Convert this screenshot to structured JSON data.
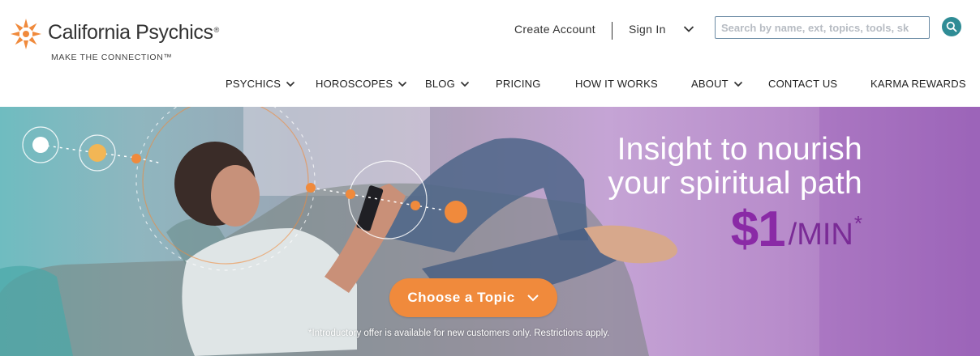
{
  "brand": {
    "name": "California Psychics",
    "registered": "®",
    "tagline": "MAKE THE CONNECTION™",
    "accent_orange": "#f08a3c",
    "accent_teal": "#2f8c95"
  },
  "header": {
    "create_account": "Create Account",
    "sign_in": "Sign In",
    "search": {
      "placeholder": "Search by name, ext, topics, tools, sk",
      "value": ""
    }
  },
  "nav": {
    "items": [
      {
        "label": "PSYCHICS",
        "has_dropdown": true
      },
      {
        "label": "HOROSCOPES",
        "has_dropdown": true
      },
      {
        "label": "BLOG",
        "has_dropdown": true
      },
      {
        "label": "PRICING",
        "has_dropdown": false
      },
      {
        "label": "HOW IT WORKS",
        "has_dropdown": false
      },
      {
        "label": "ABOUT",
        "has_dropdown": true
      },
      {
        "label": "CONTACT US",
        "has_dropdown": false
      },
      {
        "label": "KARMA REWARDS",
        "has_dropdown": false
      }
    ]
  },
  "hero": {
    "headline_line1": "Insight to nourish",
    "headline_line2": "your spiritual path",
    "price_amount": "$1",
    "price_unit": "/MIN",
    "price_asterisk": "*",
    "cta_label": "Choose a Topic",
    "disclaimer": "*Introductory offer is available for new customers only. Restrictions apply.",
    "price_color": "#8a2aa6"
  },
  "icons": {
    "logo": "sunburst-logo-icon",
    "search": "search-icon",
    "chevron": "chevron-down-icon"
  }
}
